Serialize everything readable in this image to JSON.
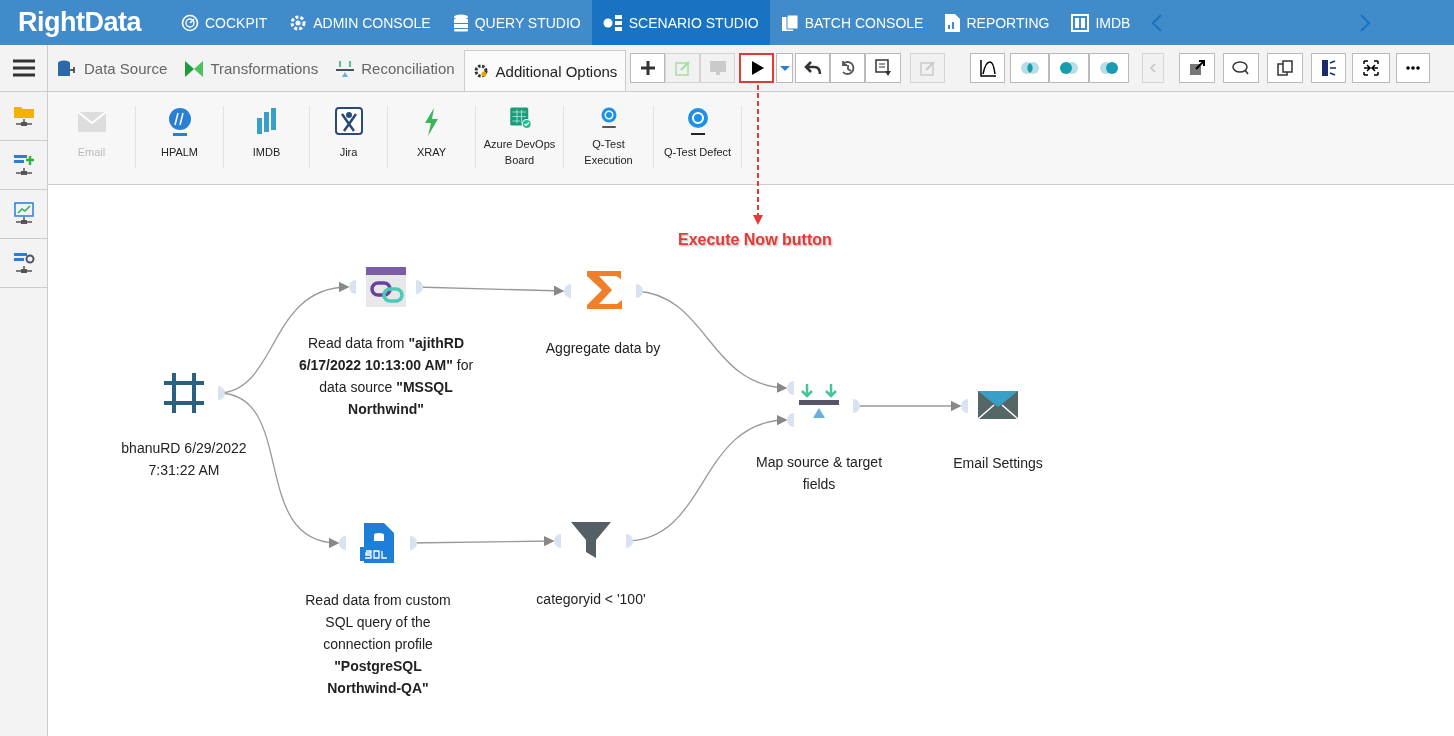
{
  "logo": "RightData",
  "nav": [
    {
      "label": "COCKPIT",
      "selected": false
    },
    {
      "label": "ADMIN CONSOLE",
      "selected": false
    },
    {
      "label": "QUERY STUDIO",
      "selected": false
    },
    {
      "label": "SCENARIO STUDIO",
      "selected": true
    },
    {
      "label": "BATCH CONSOLE",
      "selected": false
    },
    {
      "label": "REPORTING",
      "selected": false
    },
    {
      "label": "IMDB",
      "selected": false
    }
  ],
  "tabs": [
    {
      "label": "Data Source",
      "selected": false
    },
    {
      "label": "Transformations",
      "selected": false
    },
    {
      "label": "Reconciliation",
      "selected": false
    },
    {
      "label": "Additional Options",
      "selected": true
    }
  ],
  "toolbar": [
    {
      "disabled": false,
      "highlighted": false
    },
    {
      "disabled": true,
      "highlighted": false
    },
    {
      "disabled": true,
      "highlighted": false
    },
    {
      "disabled": false,
      "highlighted": true
    },
    {
      "disabled": false,
      "highlighted": false
    },
    {
      "disabled": false,
      "highlighted": false
    },
    {
      "disabled": false,
      "highlighted": false
    },
    {
      "disabled": false,
      "highlighted": false
    },
    {
      "disabled": true,
      "highlighted": false
    },
    {
      "disabled": false,
      "highlighted": false
    },
    {
      "disabled": false,
      "highlighted": false
    },
    {
      "disabled": false,
      "highlighted": false
    },
    {
      "disabled": false,
      "highlighted": false
    },
    {
      "disabled": true,
      "highlighted": false
    },
    {
      "disabled": false,
      "highlighted": false
    },
    {
      "disabled": false,
      "highlighted": false
    },
    {
      "disabled": false,
      "highlighted": false
    },
    {
      "disabled": false,
      "highlighted": false
    },
    {
      "disabled": false,
      "highlighted": false
    },
    {
      "disabled": false,
      "highlighted": false
    }
  ],
  "ribbon": [
    {
      "label": "Email",
      "disabled": true
    },
    {
      "label": "HPALM",
      "disabled": false
    },
    {
      "label": "IMDB",
      "disabled": false
    },
    {
      "label": "Jira",
      "disabled": false
    },
    {
      "label": "XRAY",
      "disabled": false
    },
    {
      "label": "Azure DevOps Board",
      "disabled": false
    },
    {
      "label": "Q-Test Execution",
      "disabled": false
    },
    {
      "label": "Q-Test Defect",
      "disabled": false
    }
  ],
  "annotation": {
    "text": "Execute Now button"
  },
  "nodes": [
    {
      "kind": "source",
      "label": "bhanuRD 6/29/2022 7:31:22 AM"
    },
    {
      "kind": "join",
      "label": "Read data from **\"ajithRD 6/17/2022 10:13:00 AM\"** for data source **\"MSSQL Northwind\"**"
    },
    {
      "kind": "aggregate",
      "label": "Aggregate data by"
    },
    {
      "kind": "map",
      "label": "Map source & target fields"
    },
    {
      "kind": "email",
      "label": "Email Settings"
    },
    {
      "kind": "sql",
      "label": "Read data from custom SQL query of the connection profile **\"PostgreSQL Northwind-QA\"**"
    },
    {
      "kind": "filter",
      "label": "categoryid < '100'"
    }
  ]
}
